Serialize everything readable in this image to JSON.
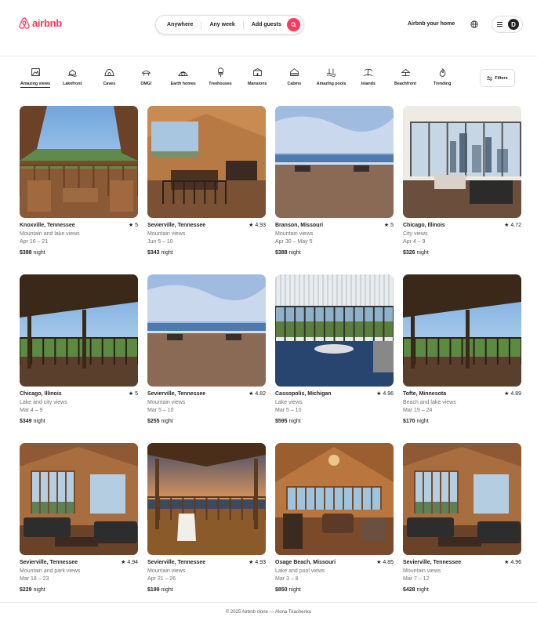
{
  "header": {
    "logo_text": "airbnb",
    "search": {
      "where": "Anywhere",
      "when": "Any week",
      "who": "Add guests"
    },
    "host_link": "Airbnb your home",
    "avatar_initial": "D"
  },
  "categories": [
    {
      "label": "Amazing views",
      "icon": "picture-frame-icon",
      "active": true
    },
    {
      "label": "Lakefront",
      "icon": "lakefront-icon"
    },
    {
      "label": "Caves",
      "icon": "cave-icon"
    },
    {
      "label": "OMG!",
      "icon": "ufo-house-icon"
    },
    {
      "label": "Earth homes",
      "icon": "earth-home-icon"
    },
    {
      "label": "Treehouses",
      "icon": "treehouse-icon"
    },
    {
      "label": "Mansions",
      "icon": "mansion-icon"
    },
    {
      "label": "Cabins",
      "icon": "cabin-icon"
    },
    {
      "label": "Amazing pools",
      "icon": "pool-icon"
    },
    {
      "label": "Islands",
      "icon": "island-icon"
    },
    {
      "label": "Beachfront",
      "icon": "beach-icon"
    },
    {
      "label": "Trending",
      "icon": "flame-icon"
    }
  ],
  "filters_label": "Filters",
  "listings": [
    {
      "location": "Knoxville, Tennessee",
      "rating": "5",
      "description": "Mountain and lake views",
      "dates": "Apr 16 – 21",
      "price": "$388",
      "price_unit": "night",
      "scene": "deck"
    },
    {
      "location": "Sevierville, Tennessee",
      "rating": "4.93",
      "description": "Mountain views",
      "dates": "Jun 5 – 10",
      "price": "$343",
      "price_unit": "night",
      "scene": "interior"
    },
    {
      "location": "Branson, Missouri",
      "rating": "5",
      "description": "Mountain views",
      "dates": "Apr 30 – May 5",
      "price": "$388",
      "price_unit": "night",
      "scene": "lake"
    },
    {
      "location": "Chicago, Illinois",
      "rating": "4.72",
      "description": "City views",
      "dates": "Apr 4 – 9",
      "price": "$326",
      "price_unit": "night",
      "scene": "city"
    },
    {
      "location": "Chicago, Illinois",
      "rating": "5",
      "description": "Lake and city views",
      "dates": "Mar 4 – 9",
      "price": "$349",
      "price_unit": "night",
      "scene": "porch"
    },
    {
      "location": "Sevierville, Tennessee",
      "rating": "4.82",
      "description": "Mountain views",
      "dates": "Mar 5 – 10",
      "price": "$255",
      "price_unit": "night",
      "scene": "lake"
    },
    {
      "location": "Cassopolis, Michigan",
      "rating": "4.96",
      "description": "Lake views",
      "dates": "Mar 5 – 10",
      "price": "$595",
      "price_unit": "night",
      "scene": "pergola"
    },
    {
      "location": "Tofte, Minnesota",
      "rating": "4.89",
      "description": "Beach and lake views",
      "dates": "Mar 19 – 24",
      "price": "$170",
      "price_unit": "night",
      "scene": "porch"
    },
    {
      "location": "Sevierville, Tennessee",
      "rating": "4.94",
      "description": "Mountain and park views",
      "dates": "Mar 18 – 23",
      "price": "$229",
      "price_unit": "night",
      "scene": "living"
    },
    {
      "location": "Sevierville, Tennessee",
      "rating": "4.93",
      "description": "Mountain views",
      "dates": "Apr 21 – 26",
      "price": "$199",
      "price_unit": "night",
      "scene": "sunset"
    },
    {
      "location": "Osage Beach, Missouri",
      "rating": "4.85",
      "description": "Lake and pool views",
      "dates": "Mar 3 – 8",
      "price": "$850",
      "price_unit": "night",
      "scene": "cabin"
    },
    {
      "location": "Sevierville, Tennessee",
      "rating": "4.96",
      "description": "Mountain views",
      "dates": "Mar 7 – 12",
      "price": "$428",
      "price_unit": "night",
      "scene": "living"
    }
  ],
  "footer_text": "© 2025 Airbnb clone — Alona Tkachenko",
  "colors": {
    "brand": "#ff385c",
    "text": "#222222",
    "muted": "#717171",
    "border": "#dddddd"
  }
}
